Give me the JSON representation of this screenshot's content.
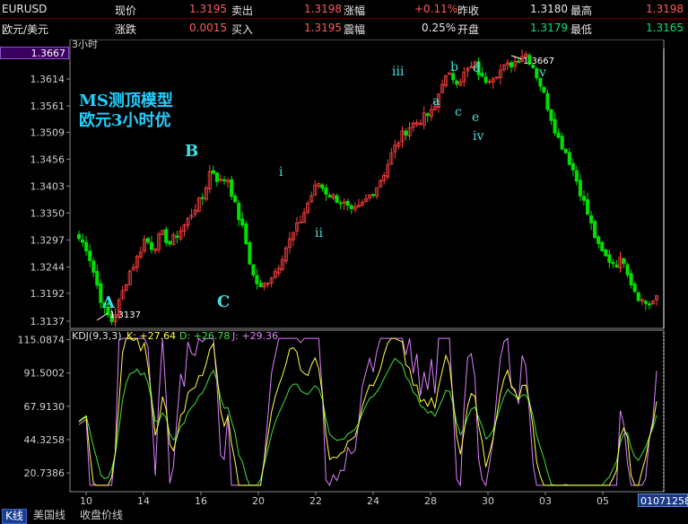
{
  "header": {
    "row1": {
      "symbol": "EURUSD",
      "last_label": "现价",
      "last_value": "1.3195",
      "bid_label": "卖出",
      "bid_value": "1.3198",
      "change_pct_label": "涨幅",
      "change_pct_value": "+0.11%",
      "prev_close_label": "昨收",
      "prev_close_value": "1.3180",
      "high_label": "最高",
      "high_value": "1.3198"
    },
    "row2": {
      "name": "欧元/美元",
      "change_label": "涨跌",
      "change_value": "0.0015",
      "ask_label": "买入",
      "ask_value": "1.3195",
      "amplitude_label": "震幅",
      "amplitude_value": "0.25%",
      "open_label": "开盘",
      "open_value": "1.3179",
      "low_label": "最低",
      "low_value": "1.3165"
    }
  },
  "price_panel": {
    "period": "3小时",
    "current_price_box": "1.3667",
    "y_ticks": [
      "1.3614",
      "1.3561",
      "1.3509",
      "1.3456",
      "1.3403",
      "1.3350",
      "1.3297",
      "1.3244",
      "1.3192",
      "1.3137"
    ],
    "title_line1": "MS测顶模型",
    "title_line2": "欧元3小时优",
    "low_annotation": "1.3137",
    "high_annotation": "1.3667",
    "wave_labels": [
      "A",
      "B",
      "C",
      "i",
      "ii",
      "iii",
      "a",
      "b",
      "c",
      "d",
      "e",
      "iv",
      "v"
    ]
  },
  "kdj_panel": {
    "title": "KDJ(9,3,3)",
    "k_label": "K: +27.64",
    "d_label": "D: +26.78",
    "j_label": "J: +29.36",
    "y_ticks": [
      "115.0874",
      "91.5002",
      "67.9130",
      "44.3258",
      "20.7386"
    ]
  },
  "x_axis": {
    "ticks": [
      "10",
      "14",
      "16",
      "20",
      "22",
      "24",
      "28",
      "30",
      "03",
      "05"
    ],
    "cursor_date": "01071258"
  },
  "tabs": [
    {
      "label": "K线",
      "active": true
    },
    {
      "label": "美国线",
      "active": false
    },
    {
      "label": "收盘价线",
      "active": false
    }
  ],
  "colors": {
    "up": "#ff4040",
    "down": "#00e000",
    "k_line": "#ffff40",
    "d_line": "#40e040",
    "j_line": "#e080ff",
    "wave_label": "#40e0e0",
    "title_text": "#20d0ff",
    "axis": "#a0a0a0"
  },
  "chart_data": {
    "type": "candlestick",
    "instrument": "EURUSD",
    "timeframe": "3小时",
    "ylim": [
      1.3137,
      1.3667
    ],
    "x_ticks": [
      "10",
      "14",
      "16",
      "20",
      "22",
      "24",
      "28",
      "30",
      "03",
      "05"
    ],
    "close_path": [
      1.33,
      1.328,
      1.322,
      1.316,
      1.3137,
      1.318,
      1.323,
      1.326,
      1.33,
      1.328,
      1.331,
      1.329,
      1.331,
      1.333,
      1.336,
      1.338,
      1.344,
      1.341,
      1.342,
      1.336,
      1.331,
      1.323,
      1.32,
      1.322,
      1.324,
      1.328,
      1.331,
      1.334,
      1.338,
      1.341,
      1.339,
      1.338,
      1.337,
      1.335,
      1.336,
      1.338,
      1.34,
      1.343,
      1.347,
      1.35,
      1.352,
      1.353,
      1.354,
      1.355,
      1.361,
      1.362,
      1.361,
      1.363,
      1.364,
      1.361,
      1.362,
      1.363,
      1.364,
      1.365,
      1.3667,
      1.364,
      1.36,
      1.355,
      1.35,
      1.347,
      1.343,
      1.338,
      1.333,
      1.328,
      1.326,
      1.325,
      1.326,
      1.321,
      1.318,
      1.317,
      1.318
    ],
    "kdj": {
      "k_last": 27.64,
      "d_last": 26.78,
      "j_last": 29.36,
      "ylim": [
        10,
        118
      ]
    }
  }
}
